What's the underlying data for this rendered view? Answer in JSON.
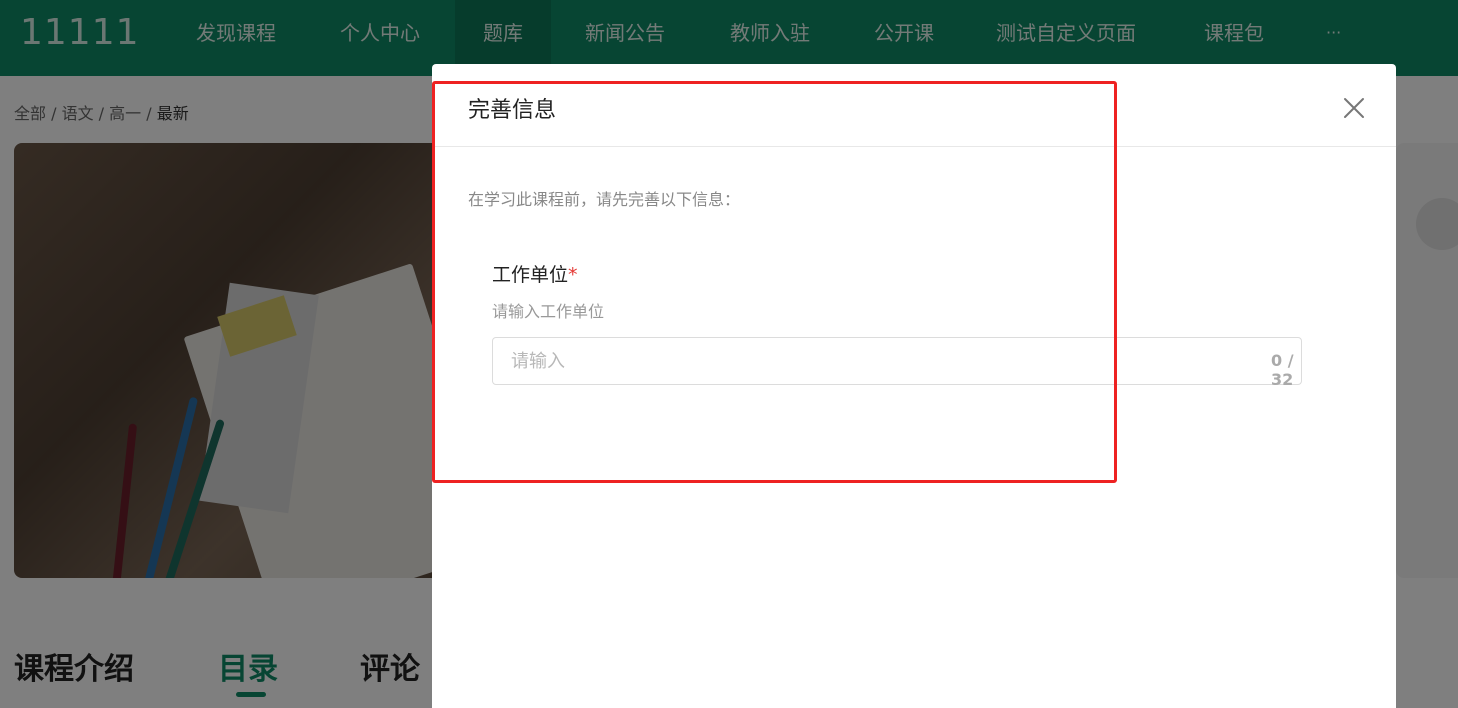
{
  "header": {
    "logo": "11111",
    "nav": [
      "发现课程",
      "个人中心",
      "题库",
      "新闻公告",
      "教师入驻",
      "公开课",
      "测试自定义页面",
      "课程包",
      "···"
    ],
    "active_index": 2,
    "brand_color": "#0f8a66"
  },
  "breadcrumb": {
    "items": [
      "全部",
      "语文",
      "高一",
      "最新"
    ],
    "separator": " / "
  },
  "tabs": {
    "intro": "课程介绍",
    "catalog": "目录",
    "comments": "评论"
  },
  "dialog": {
    "title": "完善信息",
    "close_icon": "close-icon",
    "intro_text": "在学习此课程前，请先完善以下信息：",
    "field": {
      "label": "工作单位",
      "required_mark": "*",
      "hint": "请输入工作单位",
      "placeholder": "请输入",
      "value": "",
      "counter": "0 / 32"
    }
  }
}
